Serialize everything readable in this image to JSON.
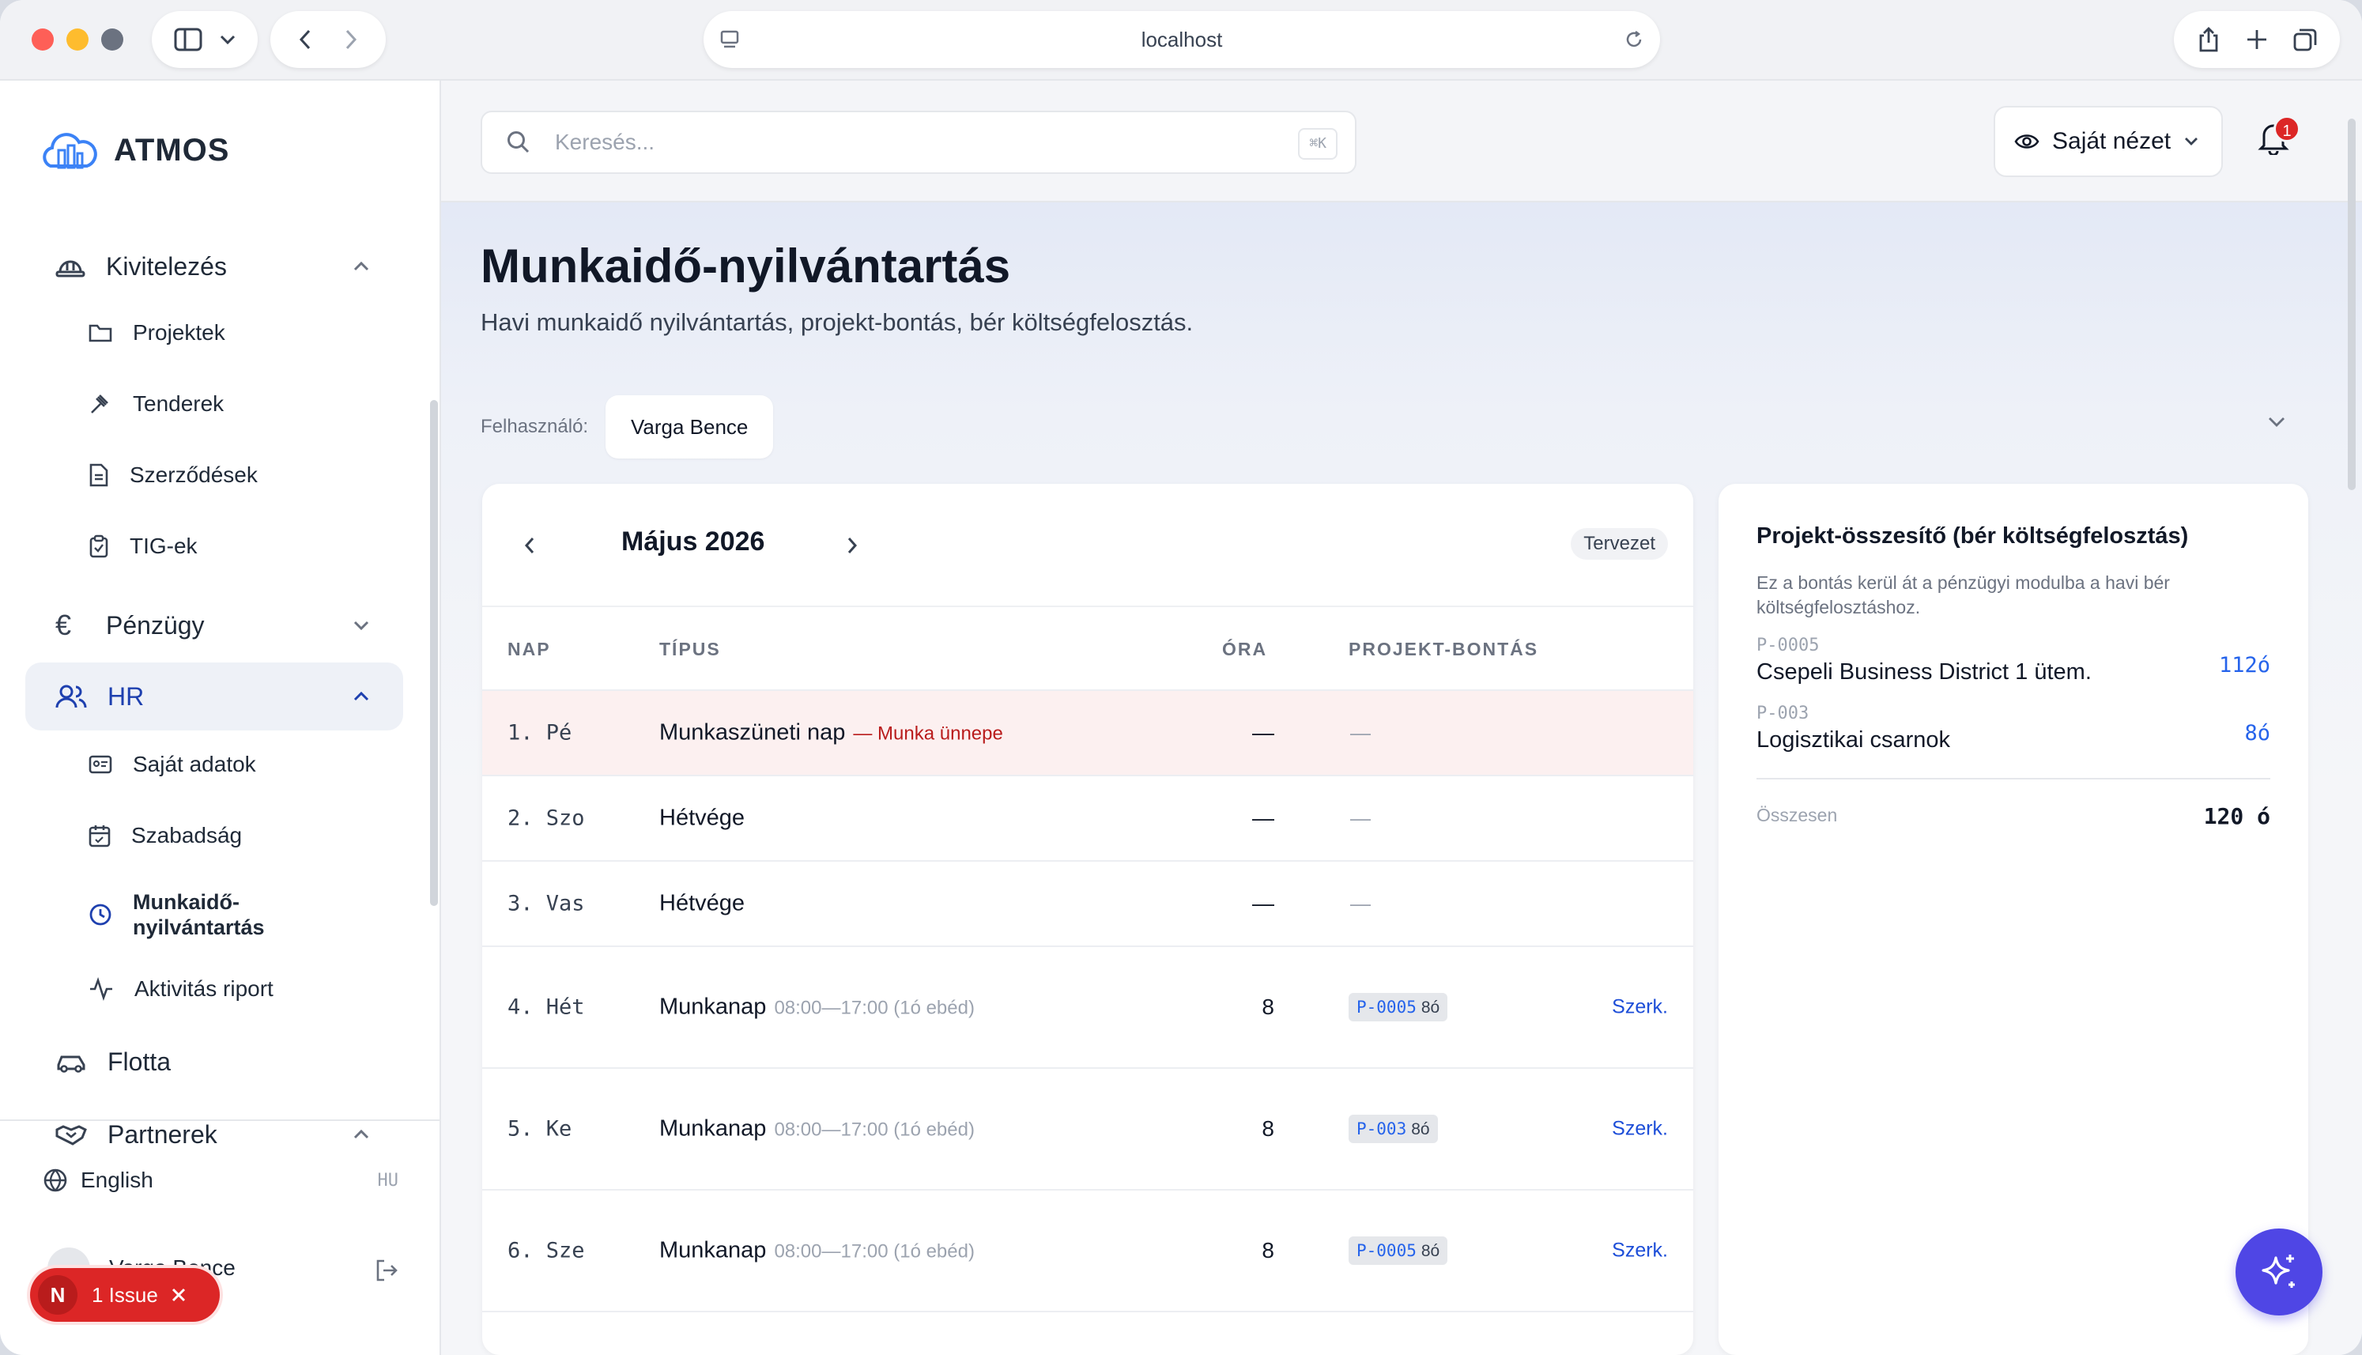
{
  "browser": {
    "url": "localhost"
  },
  "brand": {
    "name": "ATMOS"
  },
  "sidebar": {
    "sections": [
      {
        "label": "Kivitelezés",
        "icon": "hard-hat-icon"
      },
      {
        "label": "Pénzügy",
        "icon": "euro-icon"
      },
      {
        "label": "HR",
        "icon": "users-icon"
      },
      {
        "label": "Flotta",
        "icon": "car-icon"
      },
      {
        "label": "Partnerek",
        "icon": "handshake-icon"
      }
    ],
    "items": [
      {
        "label": "Projektek",
        "icon": "folder-icon"
      },
      {
        "label": "Tenderek",
        "icon": "gavel-icon"
      },
      {
        "label": "Szerződések",
        "icon": "document-icon"
      },
      {
        "label": "TIG-ek",
        "icon": "clipboard-icon"
      },
      {
        "label": "Saját adatok",
        "icon": "id-card-icon"
      },
      {
        "label": "Szabadság",
        "icon": "calendar-icon"
      },
      {
        "label": "Munkaidő-",
        "label2": "nyilvántartás",
        "icon": "clock-icon"
      },
      {
        "label": "Aktivitás riport",
        "icon": "activity-icon"
      }
    ],
    "language": {
      "label": "English",
      "code": "HU"
    },
    "user_name": "Varga Bence"
  },
  "dev": {
    "issue_label": "1 Issue",
    "logo": "N"
  },
  "header": {
    "search_placeholder": "Keresés...",
    "search_shortcut": "⌘K",
    "view_label": "Saját nézet",
    "notification_count": "1"
  },
  "page": {
    "title": "Munkaidő-nyilvántartás",
    "subtitle": "Havi munkaidő nyilvántartás, projekt-bontás, bér költségfelosztás.",
    "user_label": "Felhasználó:",
    "user_value": "Varga Bence"
  },
  "calendar": {
    "month": "Május 2026",
    "status": "Tervezet",
    "columns": {
      "day": "NAP",
      "type": "TÍPUS",
      "hours": "ÓRA",
      "split": "PROJEKT-BONTÁS"
    },
    "rows": [
      {
        "day": "1. Pé",
        "type": "Munkaszüneti nap",
        "holiday": "— Munka ünnepe",
        "hours": "—",
        "split": "—"
      },
      {
        "day": "2. Szo",
        "type": "Hétvége",
        "hours": "—",
        "split": "—"
      },
      {
        "day": "3. Vas",
        "type": "Hétvége",
        "hours": "—",
        "split": "—"
      },
      {
        "day": "4. Hét",
        "type": "Munkanap",
        "time": "08:00—17:00 (1ó ebéd)",
        "hours": "8",
        "code": "P-0005",
        "code_hours": "8ó",
        "edit": "Szerk."
      },
      {
        "day": "5. Ke",
        "type": "Munkanap",
        "time": "08:00—17:00 (1ó ebéd)",
        "hours": "8",
        "code": "P-003",
        "code_hours": "8ó",
        "edit": "Szerk."
      },
      {
        "day": "6. Sze",
        "type": "Munkanap",
        "time": "08:00—17:00 (1ó ebéd)",
        "hours": "8",
        "code": "P-0005",
        "code_hours": "8ó",
        "edit": "Szerk."
      }
    ]
  },
  "summary": {
    "title": "Projekt-összesítő (bér költségfelosztás)",
    "description": "Ez a bontás kerül át a pénzügyi modulba a havi bér költségfelosztáshoz.",
    "projects": [
      {
        "code": "P-0005",
        "name": "Csepeli Business District 1 ütem.",
        "hours": "112ó"
      },
      {
        "code": "P-003",
        "name": "Logisztikai csarnok",
        "hours": "8ó"
      }
    ],
    "total_label": "Összesen",
    "total_value": "120 ó"
  },
  "colors": {
    "accent": "#1e40af",
    "link": "#2563eb",
    "holiday": "#b91c1c",
    "fab": "#4f46e5"
  }
}
